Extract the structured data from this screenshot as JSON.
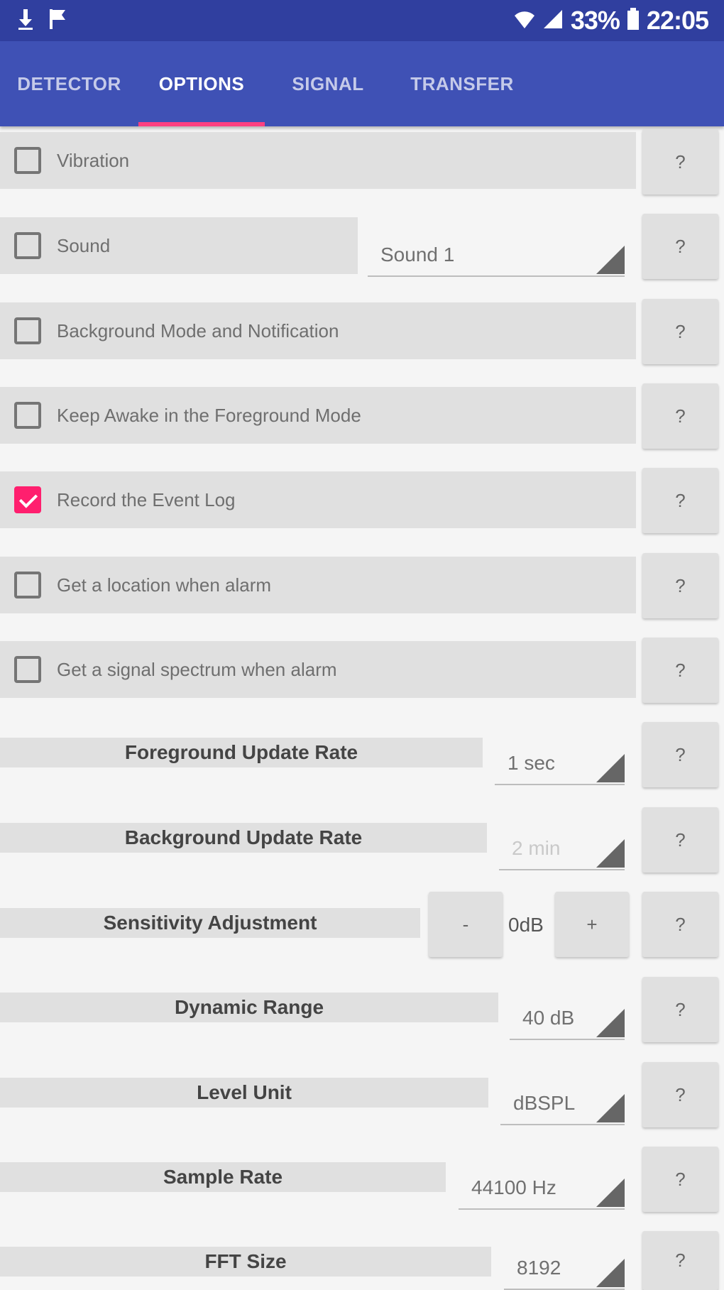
{
  "status_bar": {
    "left_icons": [
      "download-icon",
      "flag-icon"
    ],
    "battery_percent": "33%",
    "time": "22:05",
    "right_icons": [
      "wifi-icon",
      "signal-icon",
      "battery-icon"
    ]
  },
  "tabs": [
    {
      "label": "DETECTOR",
      "active": false
    },
    {
      "label": "OPTIONS",
      "active": true
    },
    {
      "label": "SIGNAL",
      "active": false
    },
    {
      "label": "TRANSFER",
      "active": false
    }
  ],
  "help_label": "?",
  "checkbox_options": [
    {
      "label": "Vibration",
      "checked": false
    },
    {
      "label": "Sound",
      "checked": false
    },
    {
      "label": "Background Mode and Notification",
      "checked": false
    },
    {
      "label": "Keep Awake in the Foreground Mode",
      "checked": false
    },
    {
      "label": "Record the Event Log",
      "checked": true
    },
    {
      "label": "Get a location when alarm",
      "checked": false
    },
    {
      "label": "Get a signal spectrum when alarm",
      "checked": false
    }
  ],
  "sound_select": {
    "value": "Sound 1"
  },
  "settings": {
    "foreground_update_rate": {
      "label": "Foreground Update Rate",
      "value": "1 sec"
    },
    "background_update_rate": {
      "label": "Background Update Rate",
      "value": "2 min"
    },
    "sensitivity_adjustment": {
      "label": "Sensitivity Adjustment",
      "value": "0dB",
      "minus": "-",
      "plus": "+"
    },
    "dynamic_range": {
      "label": "Dynamic Range",
      "value": "40 dB"
    },
    "level_unit": {
      "label": "Level Unit",
      "value": "dBSPL"
    },
    "sample_rate": {
      "label": "Sample Rate",
      "value": "44100 Hz"
    },
    "fft_size": {
      "label": "FFT Size",
      "value": "8192"
    }
  },
  "colors": {
    "status_bar": "#303f9f",
    "tab_bar": "#3f51b5",
    "tab_indicator": "#ff4081",
    "checkbox_checked": "#ff1f6e"
  }
}
